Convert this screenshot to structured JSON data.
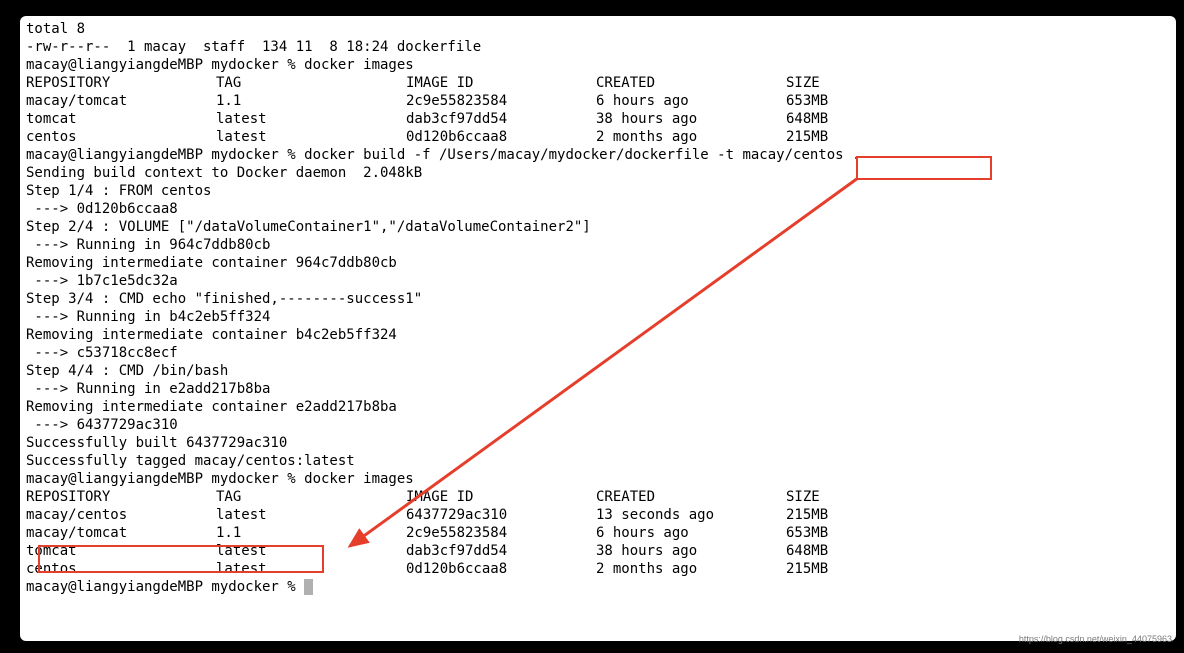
{
  "ls_header": "total 8",
  "ls_line": "-rw-r--r--  1 macay  staff  134 11  8 18:24 dockerfile",
  "prompt_host": "macay@liangyiangdeMBP",
  "prompt_dir": "mydocker",
  "prompt_sep": "%",
  "cmd_images": "docker images",
  "images_header": {
    "repo": "REPOSITORY",
    "tag": "TAG",
    "id": "IMAGE ID",
    "created": "CREATED",
    "size": "SIZE"
  },
  "images_before": [
    {
      "repo": "macay/tomcat",
      "tag": "1.1",
      "id": "2c9e55823584",
      "created": "6 hours ago",
      "size": "653MB"
    },
    {
      "repo": "tomcat",
      "tag": "latest",
      "id": "dab3cf97dd54",
      "created": "38 hours ago",
      "size": "648MB"
    },
    {
      "repo": "centos",
      "tag": "latest",
      "id": "0d120b6ccaa8",
      "created": "2 months ago",
      "size": "215MB"
    }
  ],
  "cmd_build_pre": "docker build -f /Users/macay/mydocker/dockerfile -t ",
  "cmd_build_tag": "macay/centos",
  "cmd_build_post": " .",
  "build_lines": [
    "Sending build context to Docker daemon  2.048kB",
    "Step 1/4 : FROM centos",
    " ---> 0d120b6ccaa8",
    "Step 2/4 : VOLUME [\"/dataVolumeContainer1\",\"/dataVolumeContainer2\"]",
    " ---> Running in 964c7ddb80cb",
    "Removing intermediate container 964c7ddb80cb",
    " ---> 1b7c1e5dc32a",
    "Step 3/4 : CMD echo \"finished,--------success1\"",
    " ---> Running in b4c2eb5ff324",
    "Removing intermediate container b4c2eb5ff324",
    " ---> c53718cc8ecf",
    "Step 4/4 : CMD /bin/bash",
    " ---> Running in e2add217b8ba",
    "Removing intermediate container e2add217b8ba",
    " ---> 6437729ac310",
    "Successfully built 6437729ac310",
    "Successfully tagged macay/centos:latest"
  ],
  "images_after": [
    {
      "repo": "macay/centos",
      "tag": "latest",
      "id": "6437729ac310",
      "created": "13 seconds ago",
      "size": "215MB"
    },
    {
      "repo": "macay/tomcat",
      "tag": "1.1",
      "id": "2c9e55823584",
      "created": "6 hours ago",
      "size": "653MB"
    },
    {
      "repo": "tomcat",
      "tag": "latest",
      "id": "dab3cf97dd54",
      "created": "38 hours ago",
      "size": "648MB"
    },
    {
      "repo": "centos",
      "tag": "latest",
      "id": "0d120b6ccaa8",
      "created": "2 months ago",
      "size": "215MB"
    }
  ],
  "watermark": "https://blog.csdn.net/weixin_44075963",
  "annotation_color": "#e53e2b"
}
